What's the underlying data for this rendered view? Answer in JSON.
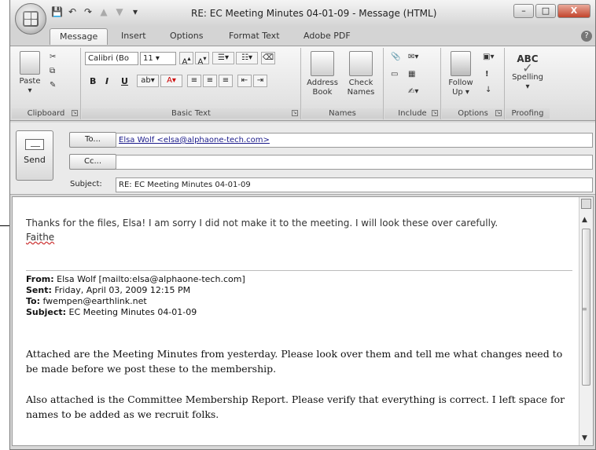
{
  "window": {
    "title": "RE: EC Meeting Minutes 04-01-09 - Message (HTML)",
    "min": "–",
    "max": "□",
    "close": "X"
  },
  "qat": {
    "save": "💾",
    "undo": "↶",
    "redo": "↷",
    "up": "▲",
    "down": "▼",
    "customize": "▾"
  },
  "tabs": [
    "Message",
    "Insert",
    "Options",
    "Format Text",
    "Adobe PDF"
  ],
  "ribbon": {
    "clipboard": {
      "label": "Clipboard",
      "paste": "Paste"
    },
    "basic_text": {
      "label": "Basic Text",
      "font": "Calibri (Bo",
      "size": "11",
      "bold": "B",
      "italic": "I",
      "underline": "U"
    },
    "names": {
      "label": "Names",
      "address_book": [
        "Address",
        "Book"
      ],
      "check_names": [
        "Check",
        "Names"
      ]
    },
    "include": {
      "label": "Include"
    },
    "options": {
      "label": "Options",
      "follow_up": [
        "Follow",
        "Up ▾"
      ]
    },
    "proofing": {
      "label": "Proofing",
      "abc": "ABC",
      "spelling": "Spelling"
    }
  },
  "message": {
    "send": "Send",
    "to_button": "To...",
    "cc_button": "Cc...",
    "subject_label": "Subject:",
    "to_value": "Elsa Wolf <elsa@alphaone-tech.com>",
    "cc_value": "",
    "subject_value": "RE: EC Meeting Minutes 04-01-09"
  },
  "body": {
    "reply_line": "Thanks for the files, Elsa!  I am sorry I did not make it to the meeting. I will look these over carefully.",
    "signature": "Faithe",
    "from_label": "From:",
    "from_value": " Elsa Wolf [mailto:elsa@alphaone-tech.com]",
    "sent_label": "Sent:",
    "sent_value": " Friday, April 03, 2009 12:15 PM",
    "to_label": "To:",
    "to_value": " fwempen@earthlink.net",
    "subject_label": "Subject:",
    "subject_value": " EC Meeting Minutes 04-01-09",
    "para1": "Attached are the Meeting Minutes from yesterday. Please look over them and tell me what changes need to be made before we post these to the membership.",
    "para2": "Also attached is the Committee Membership Report. Please verify that everything is correct. I left space for names to be added as we recruit folks."
  }
}
